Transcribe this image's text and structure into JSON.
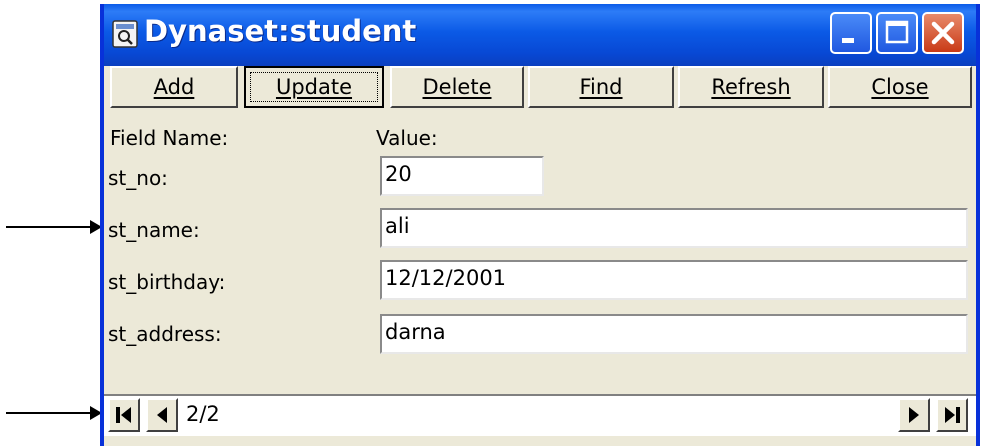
{
  "window": {
    "title": "Dynaset:student",
    "colors": {
      "titlebar": "#0a5be8",
      "body": "#ece9d8",
      "close": "#d44c2a"
    }
  },
  "toolbar": {
    "buttons": [
      {
        "label": "Add"
      },
      {
        "label": "Update"
      },
      {
        "label": "Delete"
      },
      {
        "label": "Find"
      },
      {
        "label": "Refresh"
      },
      {
        "label": "Close"
      }
    ],
    "focused": "Update"
  },
  "form": {
    "field_name_header": "Field Name:",
    "value_header": "Value:",
    "fields": [
      {
        "name": "st_no:",
        "value": "20"
      },
      {
        "name": "st_name:",
        "value": "ali"
      },
      {
        "name": "st_birthday:",
        "value": "12/12/2001"
      },
      {
        "name": "st_address:",
        "value": "darna"
      }
    ]
  },
  "navigator": {
    "record_position": "2/2"
  },
  "icons": [
    "dynaset-window-icon",
    "minimize-icon",
    "maximize-icon",
    "close-icon",
    "first-record-icon",
    "previous-record-icon",
    "next-record-icon",
    "last-record-icon",
    "arrow-icon"
  ]
}
